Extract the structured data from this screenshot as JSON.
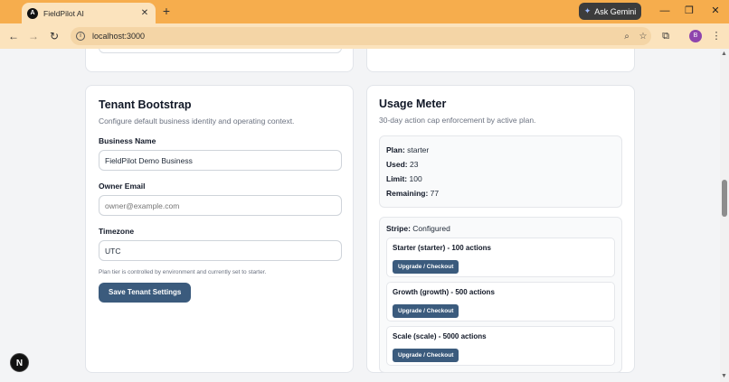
{
  "browser": {
    "tab_title": "FieldPilot AI",
    "tab_favicon": "A",
    "tab_close": "✕",
    "new_tab": "+",
    "gemini_label": "Ask Gemini",
    "minimize": "—",
    "restore": "❐",
    "close": "✕",
    "url": "localhost:3000",
    "avatar_letter": "B"
  },
  "tenant": {
    "title": "Tenant Bootstrap",
    "subtitle": "Configure default business identity and operating context.",
    "business_name_label": "Business Name",
    "business_name_value": "FieldPilot Demo Business",
    "owner_email_label": "Owner Email",
    "owner_email_placeholder": "owner@example.com",
    "timezone_label": "Timezone",
    "timezone_value": "UTC",
    "hint": "Plan tier is controlled by environment and currently set to starter.",
    "save_label": "Save Tenant Settings"
  },
  "usage": {
    "title": "Usage Meter",
    "subtitle": "30-day action cap enforcement by active plan.",
    "plan_label": "Plan:",
    "plan_value": "starter",
    "used_label": "Used:",
    "used_value": "23",
    "limit_label": "Limit:",
    "limit_value": "100",
    "remaining_label": "Remaining:",
    "remaining_value": "77",
    "stripe_label": "Stripe:",
    "stripe_value": "Configured",
    "plans": [
      {
        "name": "Starter (starter) - 100 actions",
        "button": "Upgrade / Checkout"
      },
      {
        "name": "Growth (growth) - 500 actions",
        "button": "Upgrade / Checkout"
      },
      {
        "name": "Scale (scale) - 5000 actions",
        "button": "Upgrade / Checkout"
      }
    ]
  },
  "dev_badge": "N"
}
